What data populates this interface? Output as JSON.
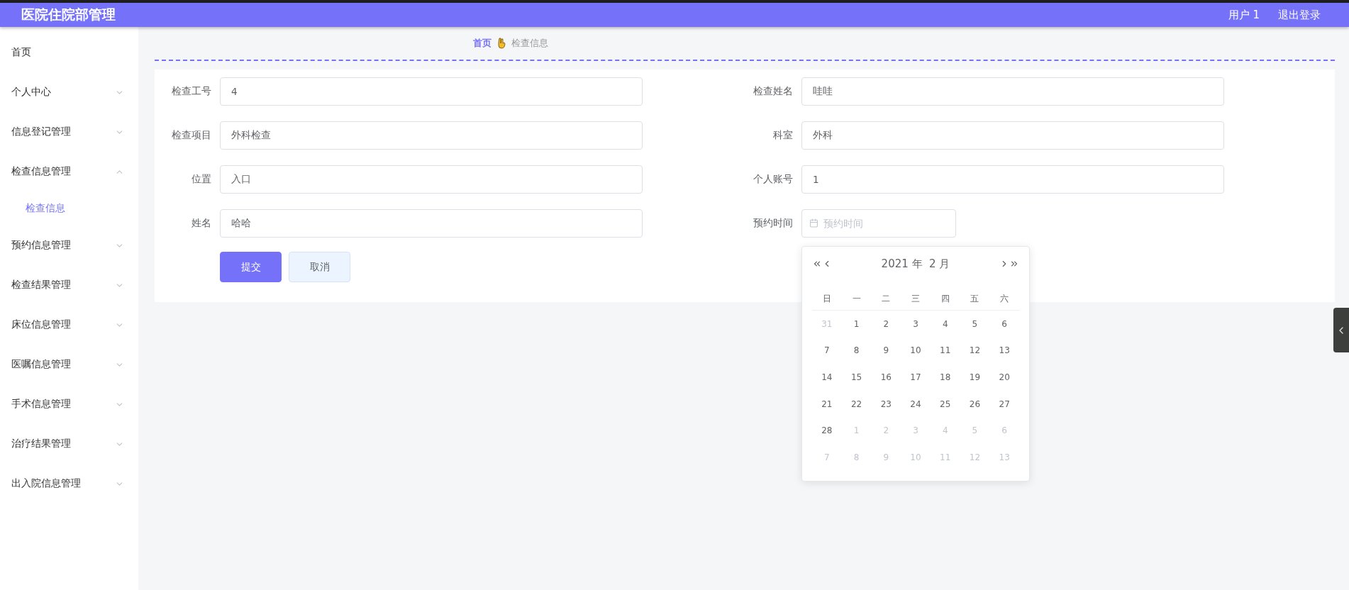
{
  "header": {
    "title": "医院住院部管理",
    "user": "用户 1",
    "logout": "退出登录"
  },
  "sidebar": {
    "items": [
      {
        "label": "首页"
      },
      {
        "label": "个人中心",
        "expandable": true,
        "expanded": false
      },
      {
        "label": "信息登记管理",
        "expandable": true,
        "expanded": false
      },
      {
        "label": "检查信息管理",
        "expandable": true,
        "expanded": true,
        "children": [
          {
            "label": "检查信息",
            "selected": true
          }
        ]
      },
      {
        "label": "预约信息管理",
        "expandable": true,
        "expanded": false
      },
      {
        "label": "检查结果管理",
        "expandable": true,
        "expanded": false
      },
      {
        "label": "床位信息管理",
        "expandable": true,
        "expanded": false
      },
      {
        "label": "医嘱信息管理",
        "expandable": true,
        "expanded": false
      },
      {
        "label": "手术信息管理",
        "expandable": true,
        "expanded": false
      },
      {
        "label": "治疗结果管理",
        "expandable": true,
        "expanded": false
      },
      {
        "label": "出入院信息管理",
        "expandable": true,
        "expanded": false
      }
    ]
  },
  "breadcrumb": {
    "home": "首页",
    "current": "检查信息"
  },
  "form": {
    "left": [
      {
        "label": "检查工号",
        "value": "4"
      },
      {
        "label": "检查项目",
        "value": "外科检查"
      },
      {
        "label": "位置",
        "value": "入口"
      },
      {
        "label": "姓名",
        "value": "哈哈"
      }
    ],
    "right": [
      {
        "label": "检查姓名",
        "kind": "text",
        "value": "哇哇"
      },
      {
        "label": "科室",
        "kind": "text",
        "value": "外科"
      },
      {
        "label": "个人账号",
        "kind": "text",
        "value": "1"
      },
      {
        "label": "预约时间",
        "kind": "date",
        "placeholder": "预约时间"
      }
    ],
    "buttons": [
      {
        "label": "提交",
        "kind": "primary"
      },
      {
        "label": "取消",
        "kind": "secondary"
      }
    ]
  },
  "date_picker": {
    "title": "2021 年  2 月",
    "weekdays": [
      "日",
      "一",
      "二",
      "三",
      "四",
      "五",
      "六"
    ],
    "days": [
      {
        "label": "31",
        "in_month": false
      },
      {
        "label": "1",
        "in_month": true
      },
      {
        "label": "2",
        "in_month": true
      },
      {
        "label": "3",
        "in_month": true
      },
      {
        "label": "4",
        "in_month": true
      },
      {
        "label": "5",
        "in_month": true
      },
      {
        "label": "6",
        "in_month": true
      },
      {
        "label": "7",
        "in_month": true
      },
      {
        "label": "8",
        "in_month": true
      },
      {
        "label": "9",
        "in_month": true
      },
      {
        "label": "10",
        "in_month": true
      },
      {
        "label": "11",
        "in_month": true
      },
      {
        "label": "12",
        "in_month": true
      },
      {
        "label": "13",
        "in_month": true
      },
      {
        "label": "14",
        "in_month": true
      },
      {
        "label": "15",
        "in_month": true
      },
      {
        "label": "16",
        "in_month": true
      },
      {
        "label": "17",
        "in_month": true
      },
      {
        "label": "18",
        "in_month": true
      },
      {
        "label": "19",
        "in_month": true
      },
      {
        "label": "20",
        "in_month": true
      },
      {
        "label": "21",
        "in_month": true
      },
      {
        "label": "22",
        "in_month": true
      },
      {
        "label": "23",
        "in_month": true
      },
      {
        "label": "24",
        "in_month": true
      },
      {
        "label": "25",
        "in_month": true
      },
      {
        "label": "26",
        "in_month": true
      },
      {
        "label": "27",
        "in_month": true
      },
      {
        "label": "28",
        "in_month": true
      },
      {
        "label": "1",
        "in_month": false
      },
      {
        "label": "2",
        "in_month": false
      },
      {
        "label": "3",
        "in_month": false
      },
      {
        "label": "4",
        "in_month": false
      },
      {
        "label": "5",
        "in_month": false
      },
      {
        "label": "6",
        "in_month": false
      },
      {
        "label": "7",
        "in_month": false
      },
      {
        "label": "8",
        "in_month": false
      },
      {
        "label": "9",
        "in_month": false
      },
      {
        "label": "10",
        "in_month": false
      },
      {
        "label": "11",
        "in_month": false
      },
      {
        "label": "12",
        "in_month": false
      },
      {
        "label": "13",
        "in_month": false
      }
    ]
  }
}
